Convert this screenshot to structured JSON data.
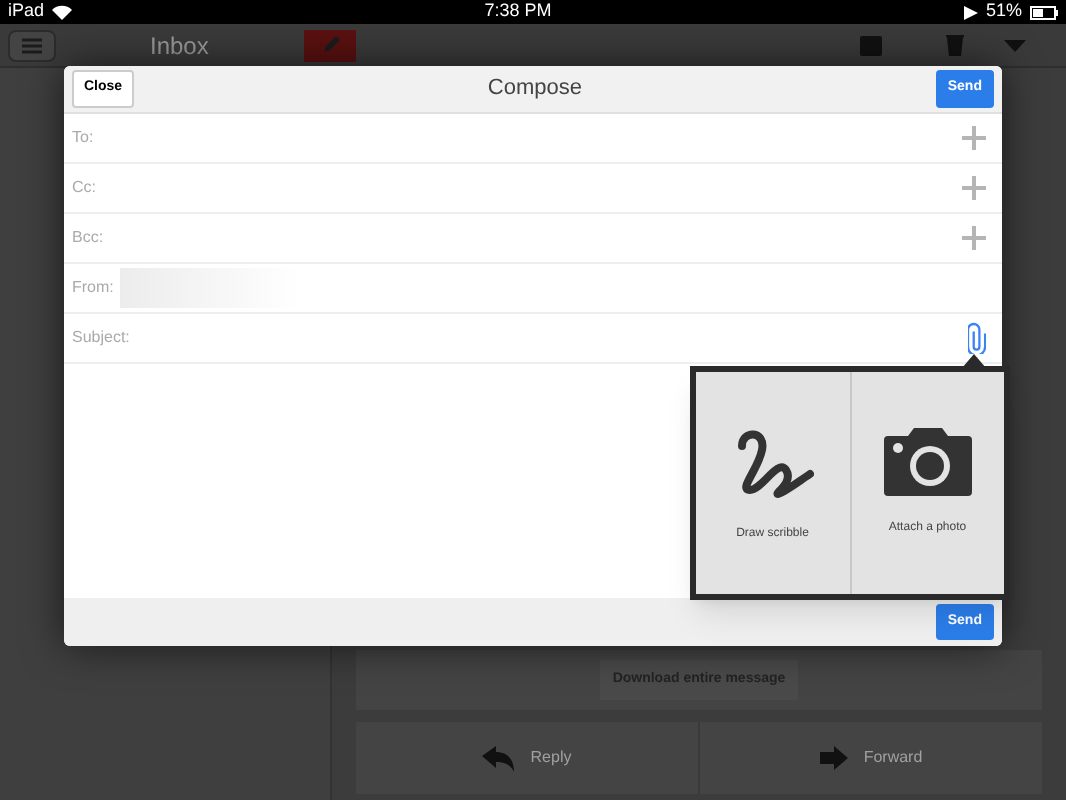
{
  "status_bar": {
    "device": "iPad",
    "time": "7:38 PM",
    "battery": "51%"
  },
  "app_bar": {
    "title": "Inbox"
  },
  "message_view": {
    "download_button": "Download entire message",
    "actions": [
      {
        "label": "Reply",
        "kind": "reply"
      },
      {
        "label": "Forward",
        "kind": "forward"
      }
    ]
  },
  "compose": {
    "title": "Compose",
    "close_button": "Close",
    "send_button": "Send",
    "fields": [
      {
        "label": "To:",
        "kind": "add"
      },
      {
        "label": "Cc:",
        "kind": "add"
      },
      {
        "label": "Bcc:",
        "kind": "add"
      },
      {
        "label": "From:",
        "kind": "blurred"
      },
      {
        "label": "Subject:",
        "kind": "attach"
      }
    ],
    "attachment_menu": [
      {
        "label": "Draw scribble",
        "kind": "scribble"
      },
      {
        "label": "Attach a photo",
        "kind": "photo"
      }
    ],
    "footer_send_button": "Send"
  }
}
